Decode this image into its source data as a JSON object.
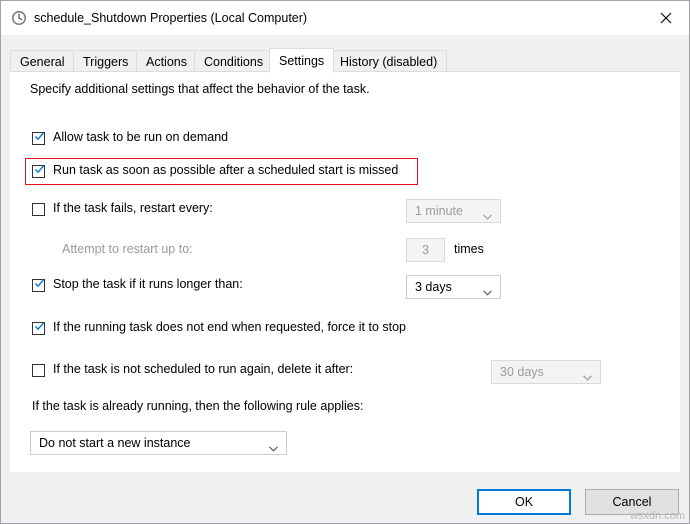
{
  "window": {
    "title": "schedule_Shutdown Properties (Local Computer)",
    "icon": "clock-icon",
    "close_label": "✕"
  },
  "tabs": [
    {
      "label": "General",
      "active": false
    },
    {
      "label": "Triggers",
      "active": false
    },
    {
      "label": "Actions",
      "active": false
    },
    {
      "label": "Conditions",
      "active": false
    },
    {
      "label": "Settings",
      "active": true
    },
    {
      "label": "History (disabled)",
      "active": false
    }
  ],
  "settings": {
    "description": "Specify additional settings that affect the behavior of the task.",
    "options": [
      {
        "label": "Allow task to be run on demand",
        "checked": true,
        "enabled": true,
        "highlighted": false
      },
      {
        "label": "Run task as soon as possible after a scheduled start is missed",
        "checked": true,
        "enabled": true,
        "highlighted": true
      },
      {
        "label": "If the task fails, restart every:",
        "checked": false,
        "enabled": true,
        "highlighted": false
      },
      {
        "label": "Stop the task if it runs longer than:",
        "checked": true,
        "enabled": true,
        "highlighted": false
      },
      {
        "label": "If the running task does not end when requested, force it to stop",
        "checked": true,
        "enabled": true,
        "highlighted": false
      },
      {
        "label": "If the task is not scheduled to run again, delete it after:",
        "checked": false,
        "enabled": true,
        "highlighted": false
      }
    ],
    "restart_interval": {
      "value": "1 minute",
      "enabled": false
    },
    "attempt_label": "Attempt to restart up to:",
    "attempt_count": "3",
    "attempt_units": "times",
    "stop_after": {
      "value": "3 days",
      "enabled": true
    },
    "delete_after": {
      "value": "30 days",
      "enabled": false
    },
    "rule_label": "If the task is already running, then the following rule applies:",
    "rule_value": "Do not start a new instance"
  },
  "footer": {
    "ok_label": "OK",
    "cancel_label": "Cancel"
  },
  "watermark": "wsxdn.com",
  "colors": {
    "accent": "#0078d7",
    "highlight": "#e81123",
    "check": "#0078d7"
  }
}
